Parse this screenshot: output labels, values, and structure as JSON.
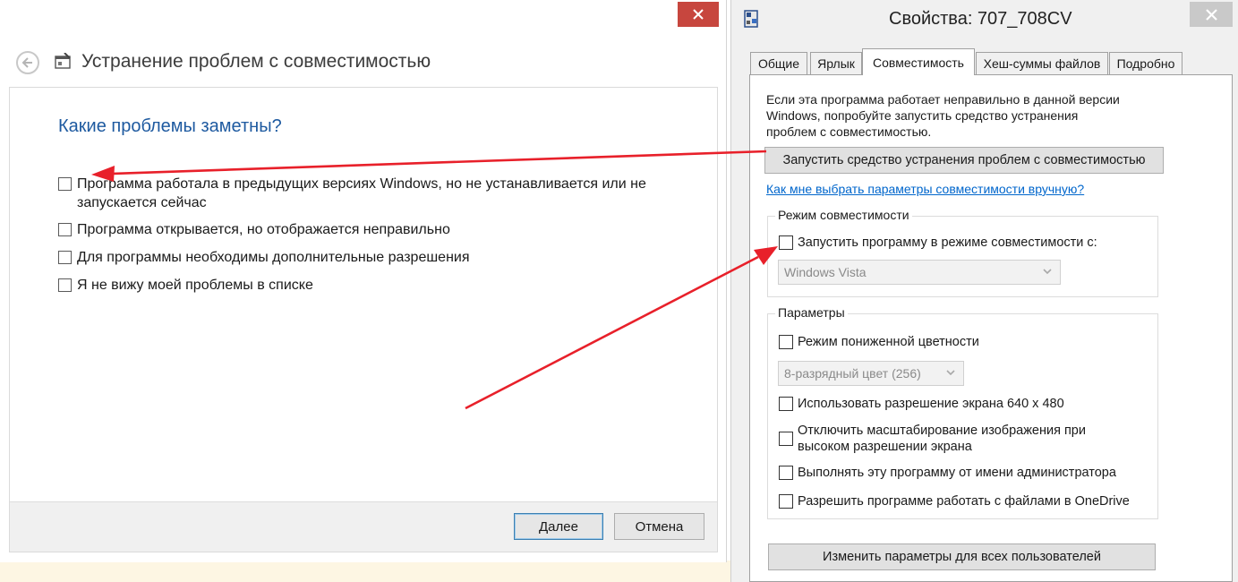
{
  "troubleshooter": {
    "title": "Устранение проблем с совместимостью",
    "question": "Какие проблемы заметны?",
    "options": [
      "Программа работала в предыдущих версиях Windows, но не устанавливается или не",
      "запускается сейчас",
      "Программа открывается, но отображается неправильно",
      "Для программы необходимы дополнительные разрешения",
      "Я не вижу моей проблемы в списке"
    ],
    "next_label": "Далее",
    "cancel_label": "Отмена"
  },
  "properties": {
    "title": "Свойства: 707_708CV",
    "tabs": [
      "Общие",
      "Ярлык",
      "Совместимость",
      "Хеш-суммы файлов",
      "Подробно"
    ],
    "intro_lines": [
      "Если эта программа работает неправильно в данной версии",
      "Windows, попробуйте запустить средство устранения",
      "проблем с совместимостью."
    ],
    "run_troubleshooter_label": "Запустить средство устранения проблем с совместимостью",
    "manual_link": "Как мне выбрать параметры совместимости вручную?",
    "compat_mode": {
      "legend": "Режим совместимости",
      "checkbox_label": "Запустить программу в режиме совместимости с:",
      "os_selected": "Windows Vista"
    },
    "params": {
      "legend": "Параметры",
      "reduced_color": "Режим пониженной цветности",
      "color_selected": "8-разрядный цвет (256)",
      "res_640": "Использовать разрешение экрана 640 x 480",
      "dpi_line1": "Отключить масштабирование изображения при",
      "dpi_line2": "высоком разрешении экрана",
      "run_as_admin": "Выполнять эту программу от имени администратора",
      "onedrive": "Разрешить программе работать с файлами в OneDrive"
    },
    "all_users_label": "Изменить параметры для всех пользователей"
  },
  "colors": {
    "arrow": "#e8202a",
    "question": "#1e5aa0",
    "link": "#0066cc",
    "close_red": "#c7463e"
  },
  "icons": [
    "close-icon",
    "back-arrow-icon",
    "troubleshooter-app-icon",
    "program-icon",
    "chevron-down-icon"
  ]
}
